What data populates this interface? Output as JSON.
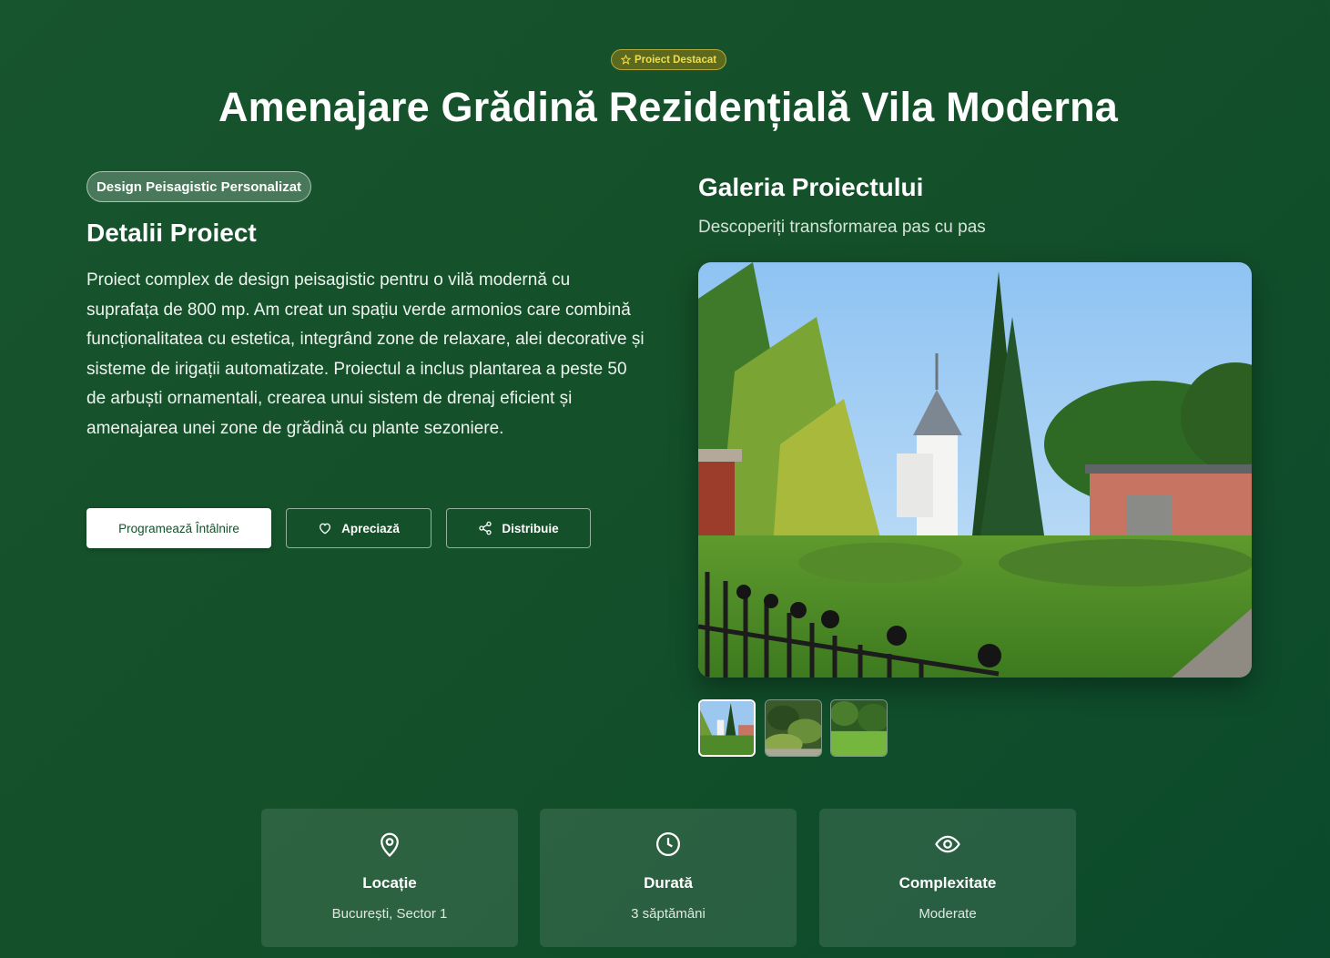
{
  "hero": {
    "badge": "Proiect Destacat",
    "title": "Amenajare Grădină Rezidențială Vila Moderna"
  },
  "details": {
    "category": "Design Peisagistic Personalizat",
    "heading": "Detalii Proiect",
    "description": "Proiect complex de design peisagistic pentru o vilă modernă cu suprafața de 800 mp. Am creat un spațiu verde armonios care combină funcționalitatea cu estetica, integrând zone de relaxare, alei decorative și sisteme de irigații automatizate. Proiectul a inclus plantarea a peste 50 de arbuști ornamentali, crearea unui sistem de drenaj eficient și amenajarea unei zone de grădină cu plante sezoniere."
  },
  "actions": {
    "primary": "Programează Întâlnire",
    "like": "Apreciază",
    "share": "Distribuie"
  },
  "gallery": {
    "title": "Galeria Proiectului",
    "subtitle": "Descoperiți transformarea pas cu pas",
    "thumbnails": [
      "thumb-villa-garden",
      "thumb-shrubs",
      "thumb-lawn"
    ],
    "selected_index": 0
  },
  "stats": [
    {
      "icon": "map-pin-icon",
      "label": "Locație",
      "value": "București, Sector 1"
    },
    {
      "icon": "clock-icon",
      "label": "Durată",
      "value": "3 săptămâni"
    },
    {
      "icon": "eye-icon",
      "label": "Complexitate",
      "value": "Moderate"
    }
  ],
  "colors": {
    "background": "#145029",
    "badge_text": "#f2dc4a",
    "primary_button_text": "#14502a"
  }
}
